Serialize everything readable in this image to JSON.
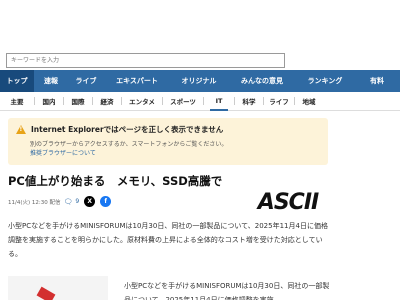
{
  "search": {
    "placeholder": "キーワードを入力"
  },
  "nav_primary": [
    {
      "label": "トップ",
      "active": true
    },
    {
      "label": "速報"
    },
    {
      "label": "ライブ"
    },
    {
      "label": "エキスパート"
    },
    {
      "label": "オリジナル"
    },
    {
      "label": "みんなの意見"
    },
    {
      "label": "ランキング"
    },
    {
      "label": "有料"
    }
  ],
  "nav_secondary": [
    {
      "label": "主要"
    },
    {
      "label": "国内"
    },
    {
      "label": "国際"
    },
    {
      "label": "経済"
    },
    {
      "label": "エンタメ"
    },
    {
      "label": "スポーツ"
    },
    {
      "label": "IT",
      "active": true
    },
    {
      "label": "科学"
    },
    {
      "label": "ライフ"
    },
    {
      "label": "地域"
    }
  ],
  "warning": {
    "icon": "warning-triangle-icon",
    "title": "Internet Explorerではページを正しく表示できません",
    "body": "別のブラウザーからアクセスするか、スマートフォンからご覧ください。",
    "link": "推奨ブラウザーについて"
  },
  "article": {
    "title": "PC値上がり始まる　メモリ、SSD高騰で",
    "meta": "11/4(火) 12:30 配信",
    "comments": "9",
    "source_logo": "ASCII",
    "lead": "小型PCなどを手がけるMINISFORUMは10月30日、同社の一部製品について、2025年11月4日に価格調整を実施することを明らかにした。原材料費の上昇による全体的なコスト増を受けた対応としている。",
    "body": "小型PCなどを手がけるMINISFORUMは10月30日、同社の一部製品について、2025年11月4日に価格調整を実施"
  },
  "colors": {
    "nav": "#2f6aa3",
    "nav_active": "#184a7c",
    "warning_bg": "#fdf3d9",
    "warning_icon": "#e8a317"
  }
}
